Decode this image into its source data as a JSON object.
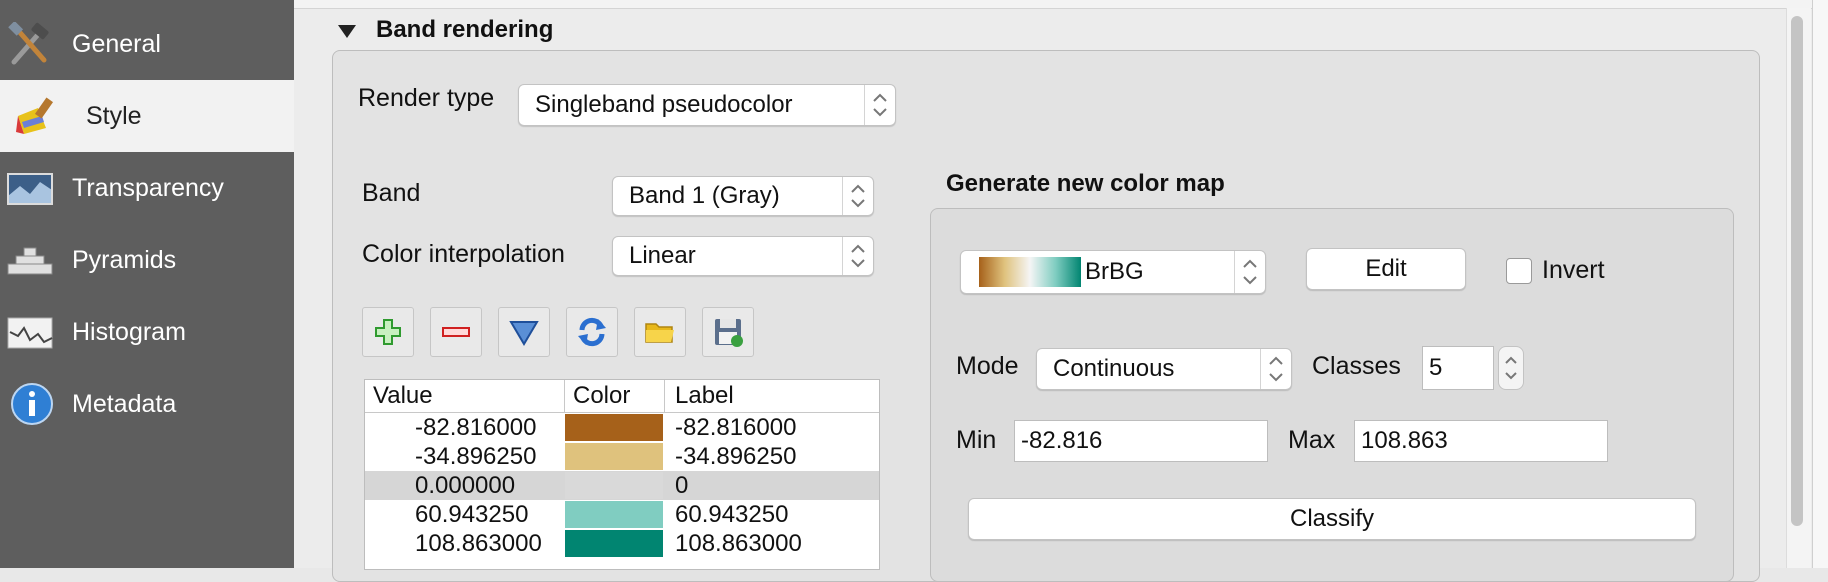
{
  "sidebar": {
    "items": [
      {
        "label": "General",
        "icon": "tools-icon",
        "selected": false
      },
      {
        "label": "Style",
        "icon": "paintbrush-icon",
        "selected": true
      },
      {
        "label": "Transparency",
        "icon": "transparency-icon",
        "selected": false
      },
      {
        "label": "Pyramids",
        "icon": "pyramids-icon",
        "selected": false
      },
      {
        "label": "Histogram",
        "icon": "histogram-icon",
        "selected": false
      },
      {
        "label": "Metadata",
        "icon": "info-icon",
        "selected": false
      }
    ]
  },
  "band_rendering": {
    "section_title": "Band rendering",
    "render_type_label": "Render type",
    "render_type_value": "Singleband pseudocolor",
    "band_label": "Band",
    "band_value": "Band 1 (Gray)",
    "interp_label": "Color interpolation",
    "interp_value": "Linear"
  },
  "toolbar": {
    "icons": [
      "add-icon",
      "remove-icon",
      "arrow-down-icon",
      "refresh-icon",
      "folder-icon",
      "save-icon"
    ]
  },
  "table": {
    "headers": {
      "value": "Value",
      "color": "Color",
      "label": "Label"
    },
    "rows": [
      {
        "value": "-82.816000",
        "color": "#a6611a",
        "label": "-82.816000",
        "selected": false
      },
      {
        "value": "-34.896250",
        "color": "#dfc27d",
        "label": "-34.896250",
        "selected": false
      },
      {
        "value": "0.000000",
        "color": "#d9d9d9",
        "label": "0",
        "selected": true
      },
      {
        "value": "60.943250",
        "color": "#80cdc1",
        "label": "60.943250",
        "selected": false
      },
      {
        "value": "108.863000",
        "color": "#018571",
        "label": "108.863000",
        "selected": false
      }
    ]
  },
  "color_map": {
    "title": "Generate new color map",
    "ramp_name": "BrBG",
    "ramp_colors": [
      "#a6611a",
      "#dfc27d",
      "#f5f5f5",
      "#80cdc1",
      "#018571"
    ],
    "edit_label": "Edit",
    "invert_label": "Invert",
    "invert_checked": false,
    "mode_label": "Mode",
    "mode_value": "Continuous",
    "classes_label": "Classes",
    "classes_value": "5",
    "min_label": "Min",
    "min_value": "-82.816",
    "max_label": "Max",
    "max_value": "108.863",
    "classify_label": "Classify"
  }
}
